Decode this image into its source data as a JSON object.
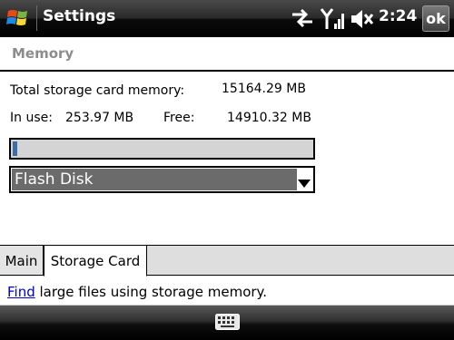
{
  "titlebar": {
    "title": "Settings",
    "time": "2:24",
    "ok_label": "ok",
    "icons": [
      "windows-start-icon",
      "connectivity-icon",
      "signal-strength-icon",
      "speaker-icon"
    ]
  },
  "page": {
    "title": "Memory"
  },
  "memory": {
    "total_label": "Total storage card memory:",
    "total_value": "15164.29 MB",
    "in_use_label": "In use:",
    "in_use_value": "253.97 MB",
    "free_label": "Free:",
    "free_value": "14910.32 MB",
    "usage_fraction": 0.0167
  },
  "storage_select": {
    "selected": "Flash Disk"
  },
  "tabs": [
    {
      "label": "Main",
      "active": false
    },
    {
      "label": "Storage Card",
      "active": true
    }
  ],
  "find": {
    "link_text": "Find",
    "rest_text": " large files using storage memory."
  },
  "bottombar": {
    "icon": "keyboard-icon"
  },
  "colors": {
    "progress_fill": "#3a6ea5",
    "link": "#0000cc",
    "selected_bg": "#6b6b6b"
  }
}
